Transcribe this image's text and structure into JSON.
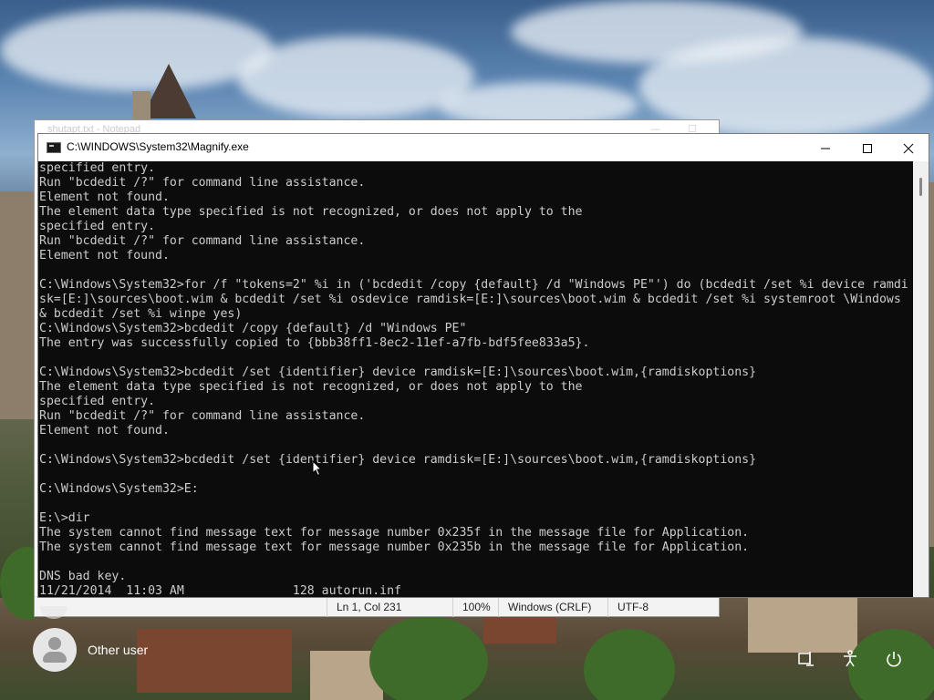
{
  "notepad": {
    "title": "shutapt.txt - Notepad",
    "status": {
      "position": "Ln 1, Col 231",
      "zoom": "100%",
      "line_ending": "Windows (CRLF)",
      "encoding": "UTF-8"
    }
  },
  "console": {
    "title": "C:\\WINDOWS\\System32\\Magnify.exe",
    "lines": [
      "specified entry.",
      "Run \"bcdedit /?\" for command line assistance.",
      "Element not found.",
      "The element data type specified is not recognized, or does not apply to the",
      "specified entry.",
      "Run \"bcdedit /?\" for command line assistance.",
      "Element not found.",
      "",
      "C:\\Windows\\System32>for /f \"tokens=2\" %i in ('bcdedit /copy {default} /d \"Windows PE\"') do (bcdedit /set %i device ramdi",
      "sk=[E:]\\sources\\boot.wim & bcdedit /set %i osdevice ramdisk=[E:]\\sources\\boot.wim & bcdedit /set %i systemroot \\Windows",
      "& bcdedit /set %i winpe yes)",
      "C:\\Windows\\System32>bcdedit /copy {default} /d \"Windows PE\"",
      "The entry was successfully copied to {bbb38ff1-8ec2-11ef-a7fb-bdf5fee833a5}.",
      "",
      "C:\\Windows\\System32>bcdedit /set {identifier} device ramdisk=[E:]\\sources\\boot.wim,{ramdiskoptions}",
      "The element data type specified is not recognized, or does not apply to the",
      "specified entry.",
      "Run \"bcdedit /?\" for command line assistance.",
      "Element not found.",
      "",
      "C:\\Windows\\System32>bcdedit /set {identifier} device ramdisk=[E:]\\sources\\boot.wim,{ramdiskoptions}",
      "",
      "C:\\Windows\\System32>E:",
      "",
      "E:\\>dir",
      "The system cannot find message text for message number 0x235f in the message file for Application.",
      "The system cannot find message text for message number 0x235b in the message file for Application.",
      "",
      "DNS bad key.",
      "11/21/2014  11:03 AM               128 autorun.inf"
    ]
  },
  "login": {
    "user_label": "Other user"
  },
  "icons": {
    "minimize": "minimize-icon",
    "maximize": "maximize-icon",
    "close": "close-icon",
    "network": "network-icon",
    "accessibility": "accessibility-icon",
    "power": "power-icon"
  }
}
